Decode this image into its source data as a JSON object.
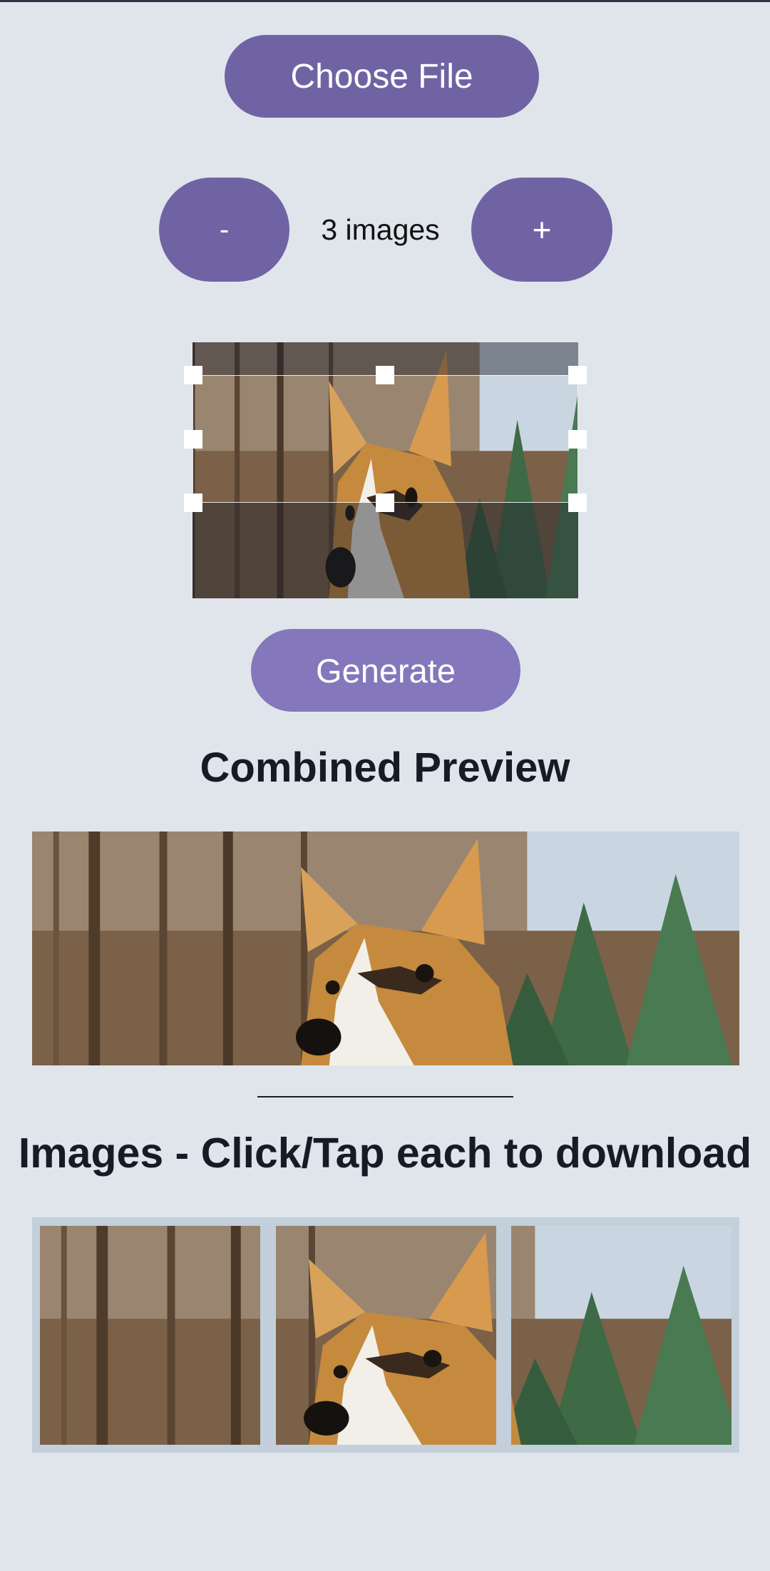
{
  "controls": {
    "choose_file_label": "Choose File",
    "decrement_label": "-",
    "increment_label": "+",
    "image_count_text": "3 images",
    "generate_label": "Generate"
  },
  "preview": {
    "title": "Combined Preview"
  },
  "images": {
    "title": "Images - Click/Tap each to download",
    "tile_count": 3
  },
  "colors": {
    "background": "#e0e5ec",
    "primary_button": "#7063a4",
    "generate_button": "#8477bb",
    "heading_text": "#161b26",
    "tiles_frame": "#c3cfdb"
  }
}
